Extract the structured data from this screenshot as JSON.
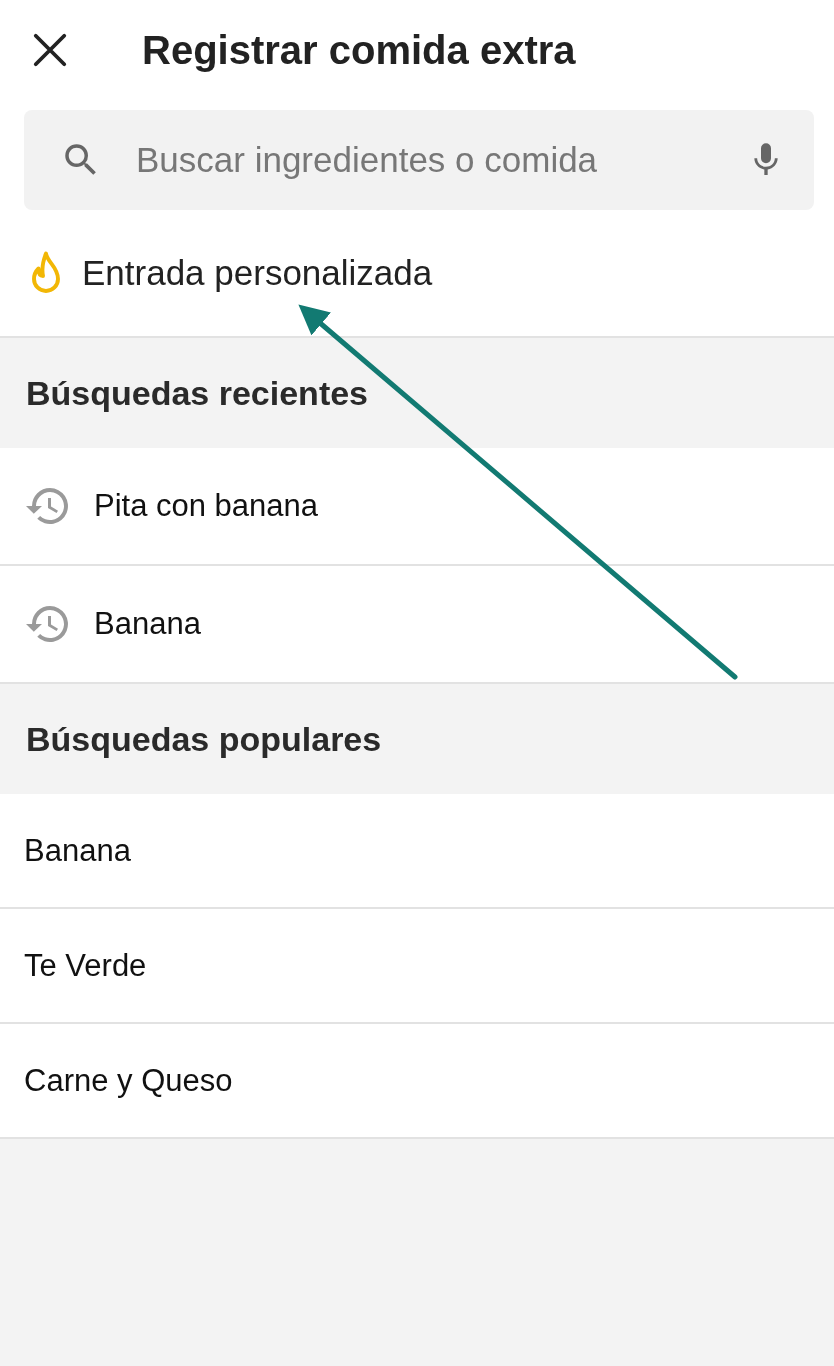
{
  "header": {
    "title": "Registrar comida extra"
  },
  "search": {
    "placeholder": "Buscar ingredientes o comida"
  },
  "custom_entry": {
    "label": "Entrada personalizada"
  },
  "sections": [
    {
      "title": "Búsquedas recientes",
      "items": [
        {
          "label": "Pita con banana",
          "kind": "recent"
        },
        {
          "label": "Banana",
          "kind": "recent"
        }
      ]
    },
    {
      "title": "Búsquedas populares",
      "items": [
        {
          "label": "Banana",
          "kind": "popular"
        },
        {
          "label": "Te Verde",
          "kind": "popular"
        },
        {
          "label": "Carne y Queso",
          "kind": "popular"
        }
      ]
    }
  ]
}
